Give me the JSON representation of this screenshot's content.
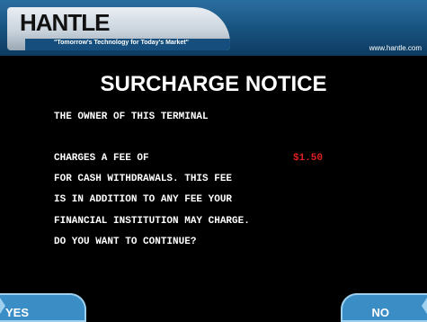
{
  "header": {
    "logo": "HANTLE",
    "tagline": "\"Tomorrow's Technology for Today's Market\"",
    "website": "www.hantle.com"
  },
  "notice": {
    "title": "SURCHARGE NOTICE",
    "line1": "THE OWNER OF THIS TERMINAL",
    "line2": "CHARGES A FEE OF",
    "fee": "$1.50",
    "line3": "FOR CASH WITHDRAWALS. THIS FEE",
    "line4": "IS IN ADDITION TO ANY FEE YOUR",
    "line5": "FINANCIAL INSTITUTION MAY CHARGE.",
    "line6": "DO YOU WANT TO CONTINUE?"
  },
  "keys": {
    "yes": "YES",
    "no": "NO"
  },
  "colors": {
    "background": "#000000",
    "header": "#1a5683",
    "key": "#3b8dc6",
    "fee": "#e02020"
  }
}
